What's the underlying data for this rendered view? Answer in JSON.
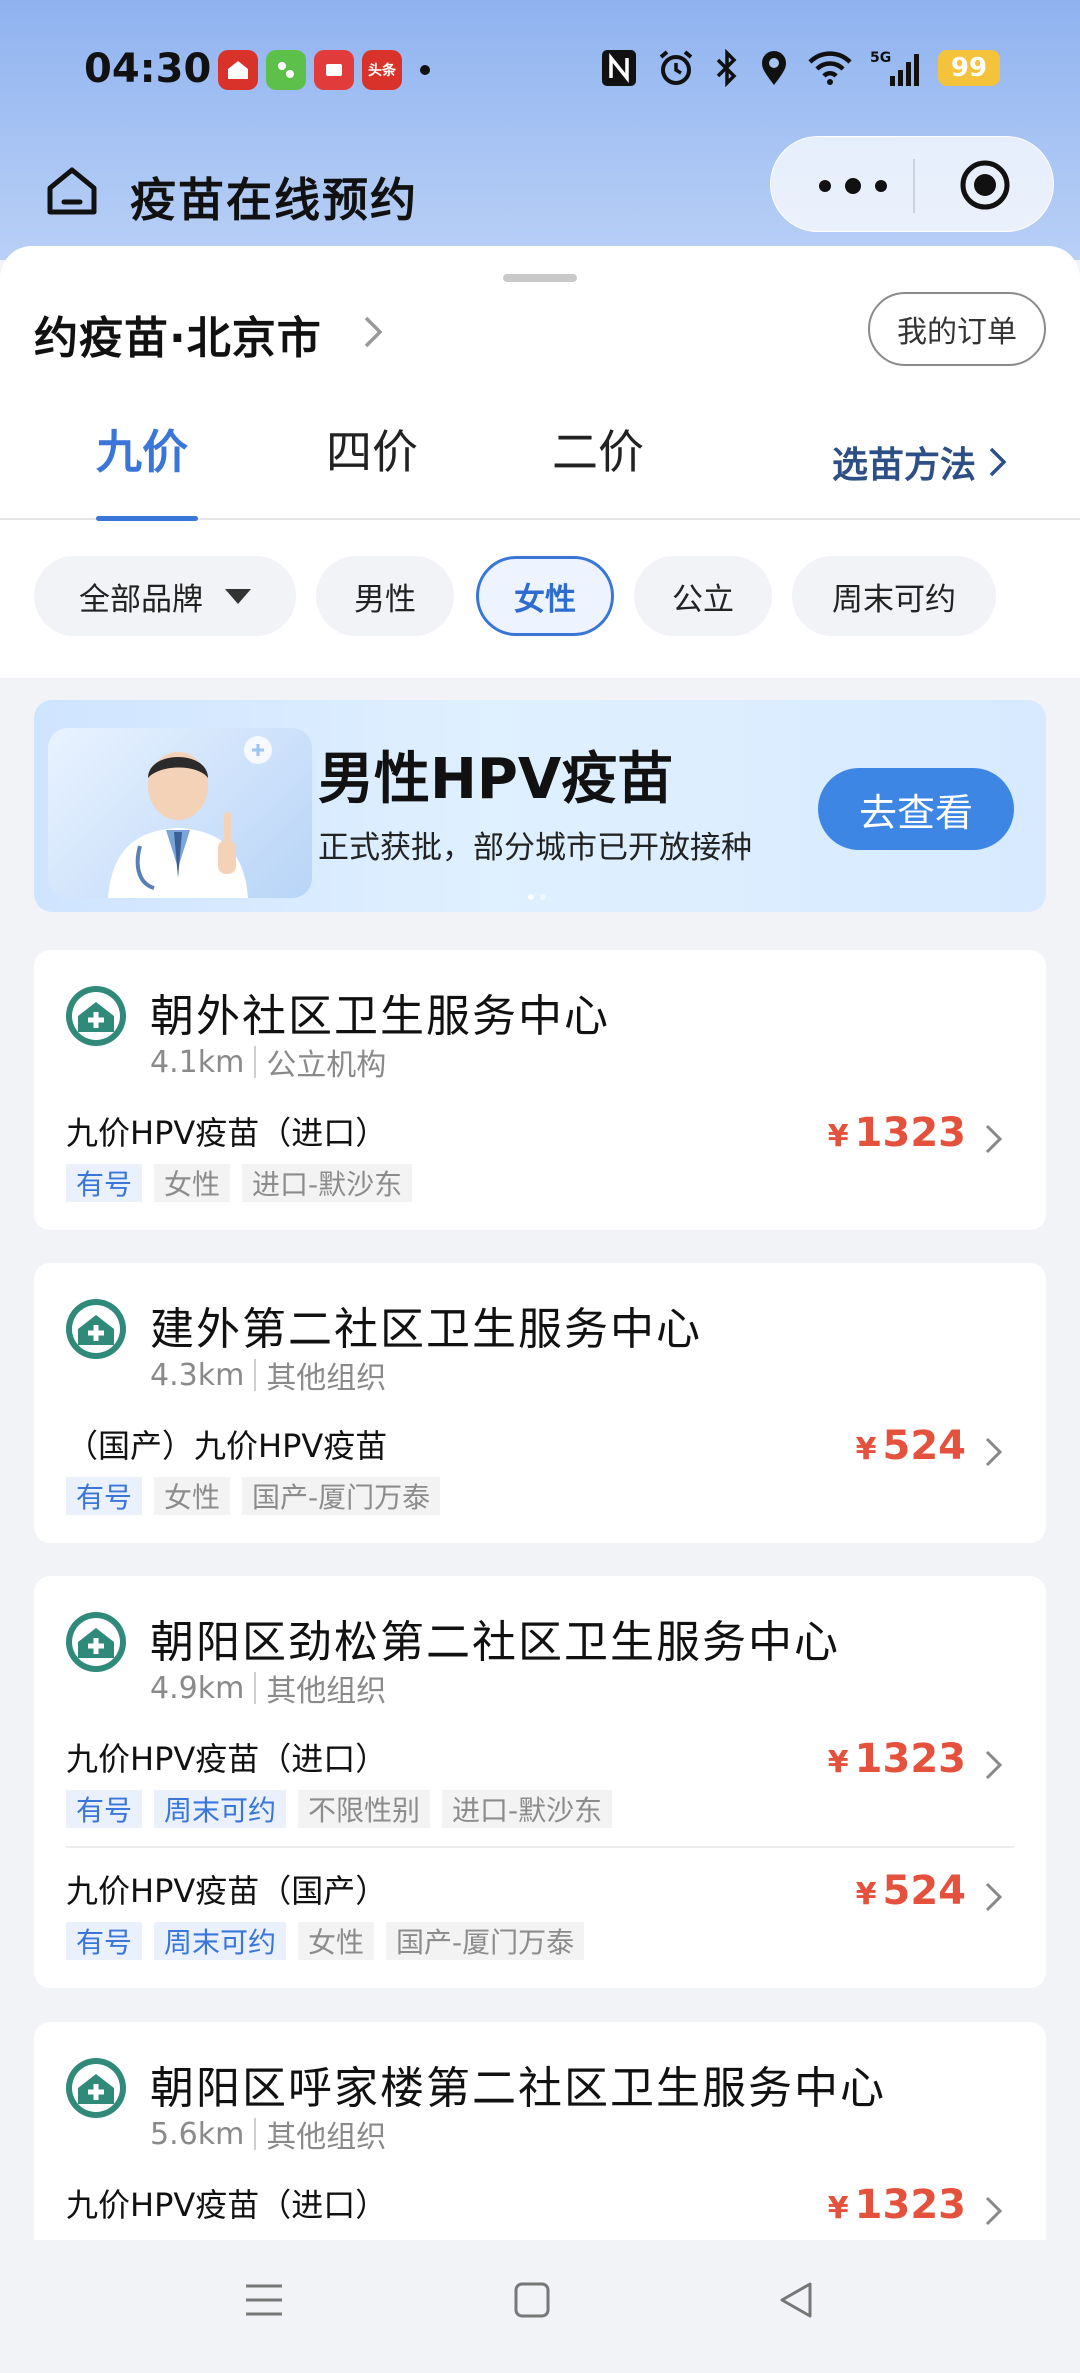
{
  "status": {
    "time": "04:30",
    "apps": [
      {
        "name": "app-icon-1",
        "color": "#d8322a",
        "label": ""
      },
      {
        "name": "app-icon-2",
        "color": "#5dc04a",
        "label": ""
      },
      {
        "name": "app-icon-3",
        "color": "#e23b3b",
        "label": ""
      },
      {
        "name": "app-icon-toutiao",
        "color": "#d8322a",
        "label": "头条"
      }
    ],
    "battery": "99"
  },
  "header": {
    "title": "疫苗在线预约"
  },
  "sheet": {
    "city_title": "约疫苗·北京市",
    "orders_button": "我的订单",
    "tabs": [
      "九价",
      "四价",
      "二价"
    ],
    "active_tab": 0,
    "pick_method": "选苗方法",
    "filters": {
      "brand": "全部品牌",
      "male": "男性",
      "female": "女性",
      "public": "公立",
      "weekend": "周末可约"
    }
  },
  "banner": {
    "title": "男性HPV疫苗",
    "subtitle": "正式获批，部分城市已开放接种",
    "button": "去查看"
  },
  "clinics": [
    {
      "name": "朝外社区卫生服务中心",
      "distance": "4.1km",
      "type": "公立机构",
      "vaccines": [
        {
          "name": "九价HPV疫苗（进口）",
          "price": "1323",
          "tags": [
            {
              "text": "有号",
              "blue": true
            },
            {
              "text": "女性",
              "blue": false
            },
            {
              "text": "进口-默沙东",
              "blue": false
            }
          ]
        }
      ]
    },
    {
      "name": "建外第二社区卫生服务中心",
      "distance": "4.3km",
      "type": "其他组织",
      "vaccines": [
        {
          "name": "（国产）九价HPV疫苗",
          "price": "524",
          "tags": [
            {
              "text": "有号",
              "blue": true
            },
            {
              "text": "女性",
              "blue": false
            },
            {
              "text": "国产-厦门万泰",
              "blue": false
            }
          ]
        }
      ]
    },
    {
      "name": "朝阳区劲松第二社区卫生服务中心",
      "distance": "4.9km",
      "type": "其他组织",
      "vaccines": [
        {
          "name": "九价HPV疫苗（进口）",
          "price": "1323",
          "tags": [
            {
              "text": "有号",
              "blue": true
            },
            {
              "text": "周末可约",
              "blue": true
            },
            {
              "text": "不限性别",
              "blue": false
            },
            {
              "text": "进口-默沙东",
              "blue": false
            }
          ]
        },
        {
          "name": "九价HPV疫苗（国产）",
          "price": "524",
          "tags": [
            {
              "text": "有号",
              "blue": true
            },
            {
              "text": "周末可约",
              "blue": true
            },
            {
              "text": "女性",
              "blue": false
            },
            {
              "text": "国产-厦门万泰",
              "blue": false
            }
          ]
        }
      ]
    },
    {
      "name": "朝阳区呼家楼第二社区卫生服务中心",
      "distance": "5.6km",
      "type": "其他组织",
      "vaccines": [
        {
          "name": "九价HPV疫苗（进口）",
          "price": "1323",
          "tags": []
        }
      ]
    }
  ],
  "currency": "¥",
  "colors": {
    "accent": "#3a76d8",
    "price": "#e4513d",
    "logo_green": "#2f8a7a"
  }
}
